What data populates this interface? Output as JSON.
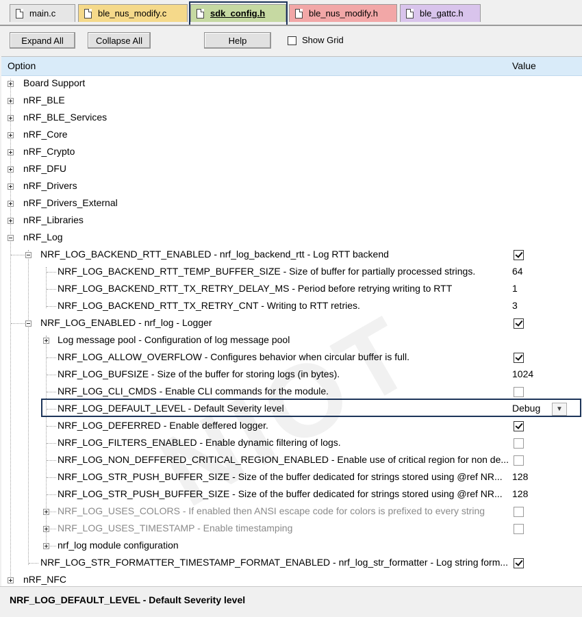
{
  "tabs": [
    {
      "label": "main.c"
    },
    {
      "label": "ble_nus_modify.c"
    },
    {
      "label": "sdk_config.h"
    },
    {
      "label": "ble_nus_modify.h"
    },
    {
      "label": "ble_gattc.h"
    }
  ],
  "toolbar": {
    "expand_all": "Expand All",
    "collapse_all": "Collapse All",
    "help": "Help",
    "show_grid": "Show Grid"
  },
  "table": {
    "col_option": "Option",
    "col_value": "Value"
  },
  "rows": [
    {
      "text": "Board Support"
    },
    {
      "text": "nRF_BLE"
    },
    {
      "text": "nRF_BLE_Services"
    },
    {
      "text": "nRF_Core"
    },
    {
      "text": "nRF_Crypto"
    },
    {
      "text": "nRF_DFU"
    },
    {
      "text": "nRF_Drivers"
    },
    {
      "text": "nRF_Drivers_External"
    },
    {
      "text": "nRF_Libraries"
    },
    {
      "text": "nRF_Log"
    },
    {
      "text": "NRF_LOG_BACKEND_RTT_ENABLED - nrf_log_backend_rtt - Log RTT backend",
      "checked": true
    },
    {
      "text": "NRF_LOG_BACKEND_RTT_TEMP_BUFFER_SIZE - Size of buffer for partially processed strings.",
      "value": "64"
    },
    {
      "text": "NRF_LOG_BACKEND_RTT_TX_RETRY_DELAY_MS - Period before retrying writing to RTT",
      "value": "1"
    },
    {
      "text": "NRF_LOG_BACKEND_RTT_TX_RETRY_CNT - Writing to RTT retries.",
      "value": "3"
    },
    {
      "text": "NRF_LOG_ENABLED - nrf_log - Logger",
      "checked": true
    },
    {
      "text": "Log message pool - Configuration of log message pool"
    },
    {
      "text": "NRF_LOG_ALLOW_OVERFLOW  - Configures behavior when circular buffer is full.",
      "checked": true
    },
    {
      "text": "NRF_LOG_BUFSIZE  - Size of the buffer for storing logs (in bytes).",
      "value": "1024"
    },
    {
      "text": "NRF_LOG_CLI_CMDS  - Enable CLI commands for the module.",
      "checked": false
    },
    {
      "text": "NRF_LOG_DEFAULT_LEVEL  - Default Severity level",
      "value": "Debug"
    },
    {
      "text": "NRF_LOG_DEFERRED  - Enable deffered logger.",
      "checked": true
    },
    {
      "text": "NRF_LOG_FILTERS_ENABLED  - Enable dynamic filtering of logs.",
      "checked": false
    },
    {
      "text": "NRF_LOG_NON_DEFFERED_CRITICAL_REGION_ENABLED  - Enable use of critical region for non de...",
      "checked": false
    },
    {
      "text": "NRF_LOG_STR_PUSH_BUFFER_SIZE  - Size of the buffer dedicated for strings stored using @ref NR...",
      "value": "128"
    },
    {
      "text": "NRF_LOG_STR_PUSH_BUFFER_SIZE  - Size of the buffer dedicated for strings stored using @ref NR...",
      "value": "128"
    },
    {
      "text": "NRF_LOG_USES_COLORS - If enabled then ANSI escape code for colors is prefixed to every string",
      "checked": false
    },
    {
      "text": "NRF_LOG_USES_TIMESTAMP - Enable timestamping",
      "checked": false
    },
    {
      "text": "nrf_log module configuration"
    },
    {
      "text": "NRF_LOG_STR_FORMATTER_TIMESTAMP_FORMAT_ENABLED  - nrf_log_str_formatter - Log string form...",
      "checked": true
    },
    {
      "text": "nRF_NFC"
    }
  ],
  "description": "NRF_LOG_DEFAULT_LEVEL  - Default Severity level",
  "watermark": "NIOT"
}
